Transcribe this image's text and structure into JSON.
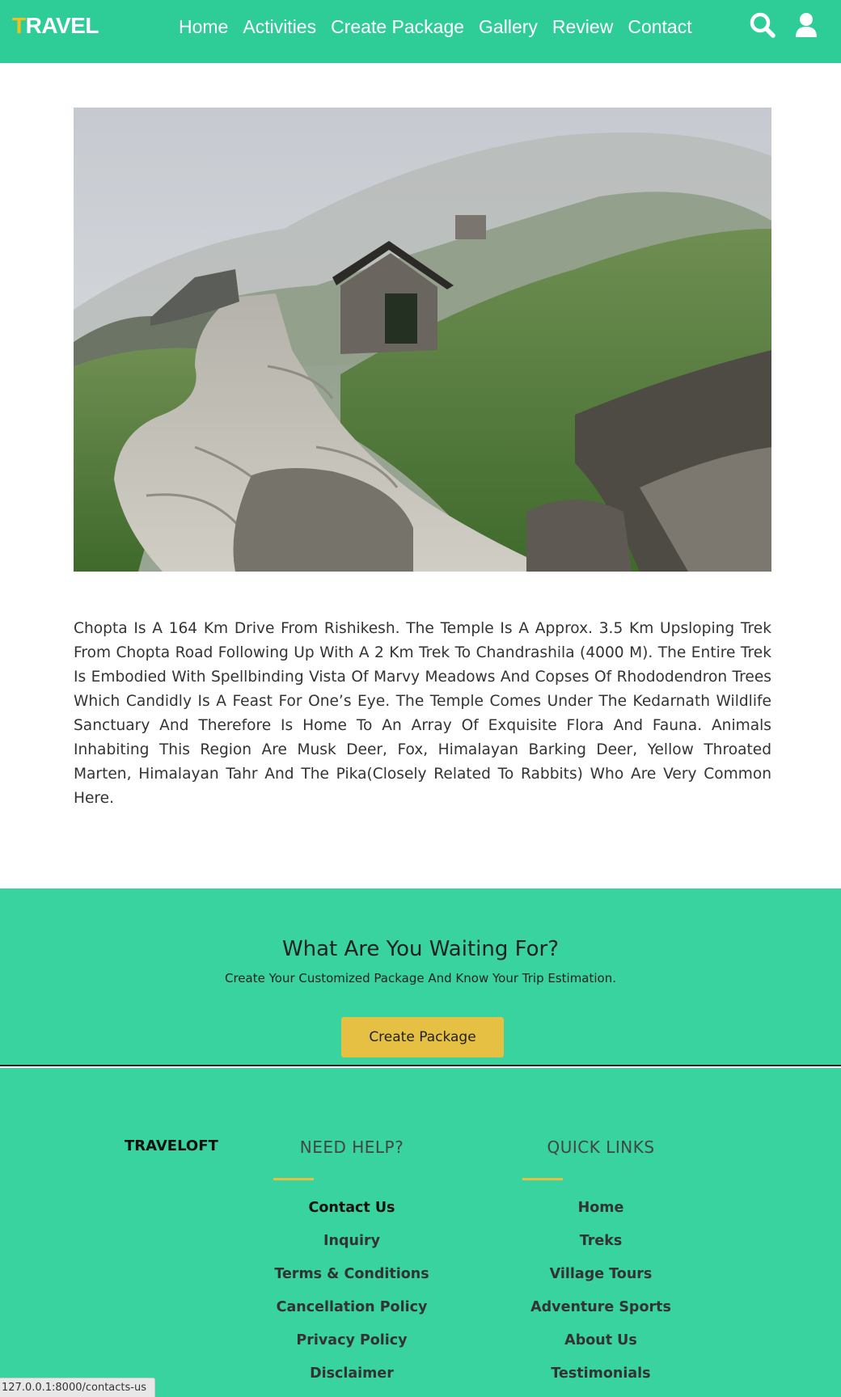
{
  "nav": {
    "logo_first": "T",
    "logo_rest": "RAVEL",
    "menu": [
      "Home",
      "Activities",
      "Create Package",
      "Gallery",
      "Review",
      "Contact"
    ],
    "icons": [
      "search-icon",
      "user-icon"
    ],
    "background": "#2ecc96",
    "logo_accent": "#f0c020"
  },
  "description": "Chopta Is A 164 Km Drive From Rishikesh. The Temple Is A Approx. 3.5 Km Upsloping Trek From Chopta Road Following Up With A 2 Km Trek To Chandrashila (4000 M). The Entire Trek Is Embodied With Spellbinding Vista Of Marvy Meadows And Copses Of Rhododendron Trees Which Candidly Is A Feast For One’s Eye. The Temple Comes Under The Kedarnath Wildlife Sanctuary And Therefore Is Home To An Array Of Exquisite Flora And Fauna. Animals Inhabiting This Region Are Musk Deer, Fox, Himalayan Barking Deer, Yellow Throated Marten, Himalayan Tahr And The Pika(Closely Related To Rabbits) Who Are Very Common Here.",
  "cta": {
    "title": "What Are You Waiting For?",
    "subtitle": "Create Your Customized Package And Know Your Trip Estimation.",
    "button": "Create Package",
    "background": "#38d39f",
    "button_color": "#e5c043"
  },
  "footer": {
    "brand": "TRAVELOFT",
    "help": {
      "heading": "NEED HELP?",
      "links": [
        "Contact Us",
        "Inquiry",
        "Terms & Conditions",
        "Cancellation Policy",
        "Privacy Policy",
        "Disclaimer"
      ]
    },
    "quick": {
      "heading": "QUICK LINKS",
      "links": [
        "Home",
        "Treks",
        "Village Tours",
        "Adventure Sports",
        "About Us",
        "Testimonials"
      ]
    }
  },
  "status_url": "127.0.0.1:8000/contacts-us"
}
